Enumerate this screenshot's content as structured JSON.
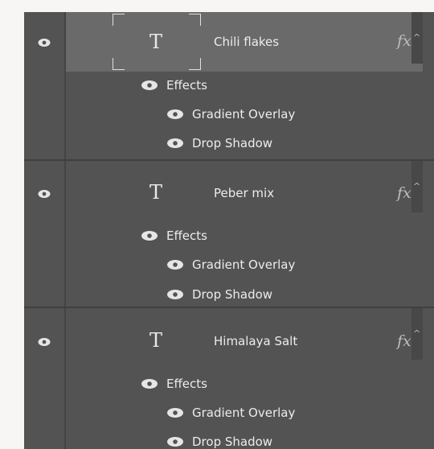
{
  "layers": [
    {
      "name": "Chili flakes",
      "type_glyph": "T",
      "fx": "fx",
      "selected": true,
      "effects_label": "Effects",
      "effects": [
        "Gradient Overlay",
        "Drop Shadow"
      ]
    },
    {
      "name": "Peber mix",
      "type_glyph": "T",
      "fx": "fx",
      "selected": false,
      "effects_label": "Effects",
      "effects": [
        "Gradient Overlay",
        "Drop Shadow"
      ]
    },
    {
      "name": "Himalaya Salt",
      "type_glyph": "T",
      "fx": "fx",
      "selected": false,
      "effects_label": "Effects",
      "effects": [
        "Gradient Overlay",
        "Drop Shadow"
      ]
    }
  ],
  "icons": {
    "visibility": "eye-icon",
    "text_layer": "text-layer-icon",
    "fx": "fx-icon",
    "collapse": "chevron-up-icon"
  },
  "colors": {
    "panel": "#535353",
    "selected_row": "#6a6a6a",
    "text": "#ececec",
    "separator": "#3f3f3f"
  }
}
